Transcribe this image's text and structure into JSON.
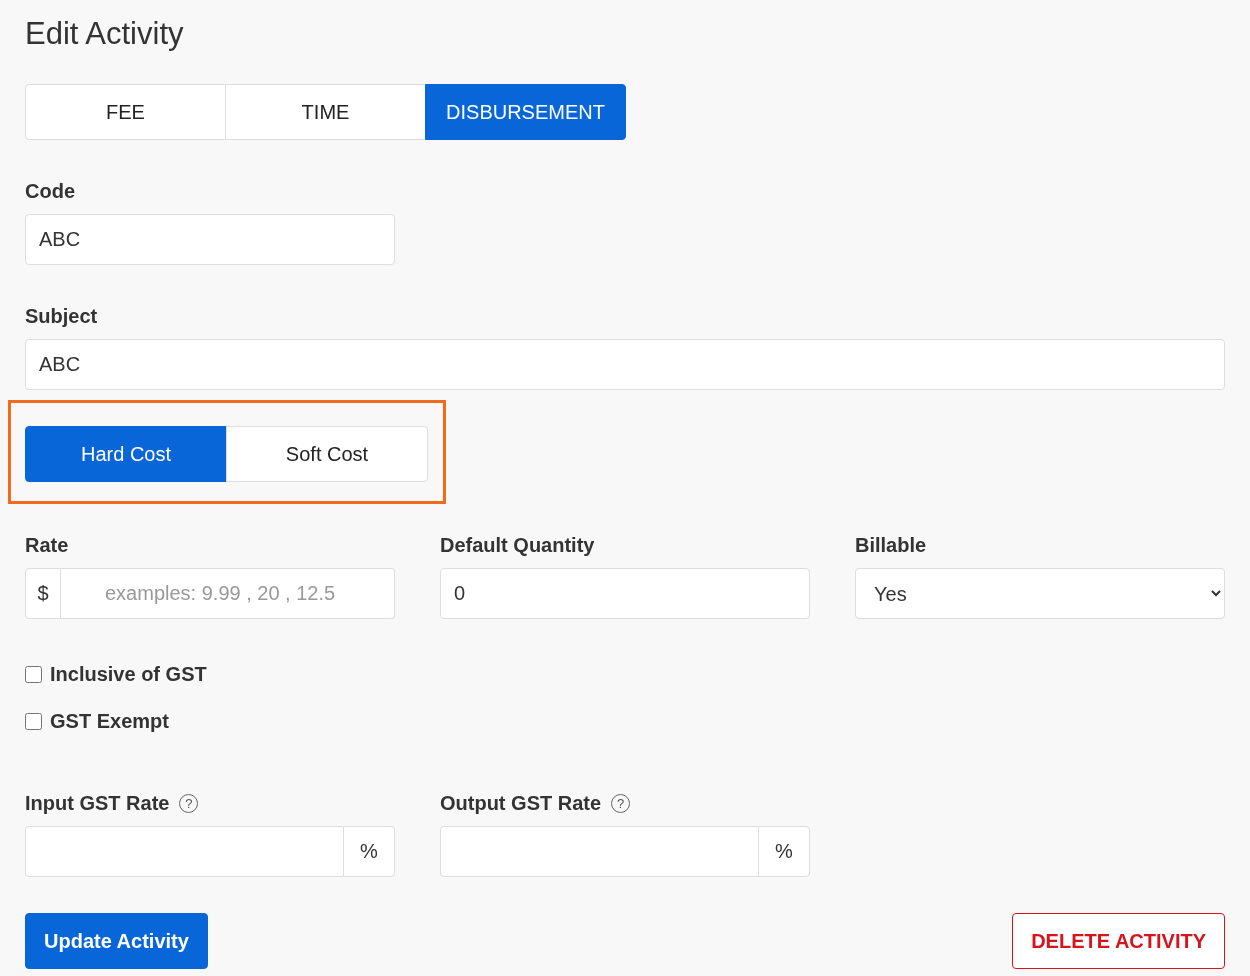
{
  "title": "Edit Activity",
  "type_tabs": [
    {
      "label": "FEE",
      "selected": false
    },
    {
      "label": "TIME",
      "selected": false
    },
    {
      "label": "DISBURSEMENT",
      "selected": true
    }
  ],
  "code": {
    "label": "Code",
    "value": "ABC"
  },
  "subject": {
    "label": "Subject",
    "value": "ABC"
  },
  "cost_toggle": [
    {
      "label": "Hard Cost",
      "selected": true
    },
    {
      "label": "Soft Cost",
      "selected": false
    }
  ],
  "rate": {
    "label": "Rate",
    "prefix": "$",
    "placeholder": "examples: 9.99 , 20 , 12.5"
  },
  "default_quantity": {
    "label": "Default Quantity",
    "value": "0"
  },
  "billable": {
    "label": "Billable",
    "value": "Yes"
  },
  "checkboxes": [
    {
      "label": "Inclusive of GST",
      "checked": false
    },
    {
      "label": "GST Exempt",
      "checked": false
    }
  ],
  "gst_rates": [
    {
      "label": "Input GST Rate",
      "help": "?",
      "suffix": "%"
    },
    {
      "label": "Output GST Rate",
      "help": "?",
      "suffix": "%"
    }
  ],
  "buttons": [
    {
      "kind": "primary",
      "label": "Update Activity"
    },
    {
      "kind": "danger",
      "label": "DELETE ACTIVITY"
    }
  ]
}
